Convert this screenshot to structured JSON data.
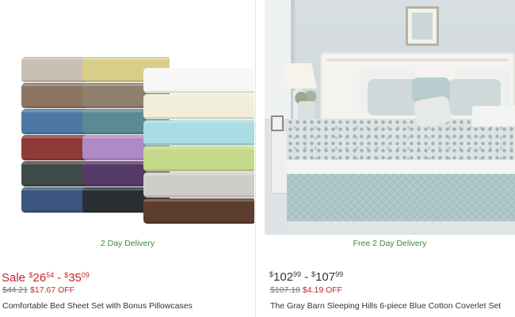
{
  "colors": {
    "sale_red": "#c0262b",
    "delivery_green": "#3a8a3c",
    "strike_gray": "#777777",
    "text": "#333333"
  },
  "products": [
    {
      "image_alt": "Stacks of folded bed sheets in many colors",
      "delivery": "2 Day Delivery",
      "sale_label": "Sale",
      "price_low": {
        "currency": "$",
        "dollars": "26",
        "cents": "54"
      },
      "price_high": {
        "currency": "$",
        "dollars": "35",
        "cents": "09"
      },
      "dash": "-",
      "original_price": "$44.21",
      "savings": "$17.67 OFF",
      "title": "Comfortable Bed Sheet Set with Bonus Pillowcases",
      "sheet_colors": {
        "stack_left": [
          "#c9bfb4",
          "#8c7563",
          "#4d78a6",
          "#8e3a36",
          "#3f4a48",
          "#3a557e"
        ],
        "stack_mid": [
          "#d9cd8a",
          "#8f806b",
          "#5a8a94",
          "#b08ac4",
          "#553a67",
          "#2b2f33"
        ],
        "stack_right": [
          "#f7f7f5",
          "#f2eed8",
          "#a9dce3",
          "#c4d98a",
          "#cfcdc9",
          "#5c3d2e"
        ]
      }
    },
    {
      "image_alt": "Bedroom with blue floral cotton coverlet",
      "delivery": "Free 2 Day Delivery",
      "price_low": {
        "currency": "$",
        "dollars": "102",
        "cents": "99"
      },
      "price_high": {
        "currency": "$",
        "dollars": "107",
        "cents": "99"
      },
      "dash": "-",
      "original_price": "$107.18",
      "savings": "$4.19 OFF",
      "title": "The Gray Barn Sleeping Hills 6-piece Blue Cotton Coverlet Set"
    }
  ]
}
